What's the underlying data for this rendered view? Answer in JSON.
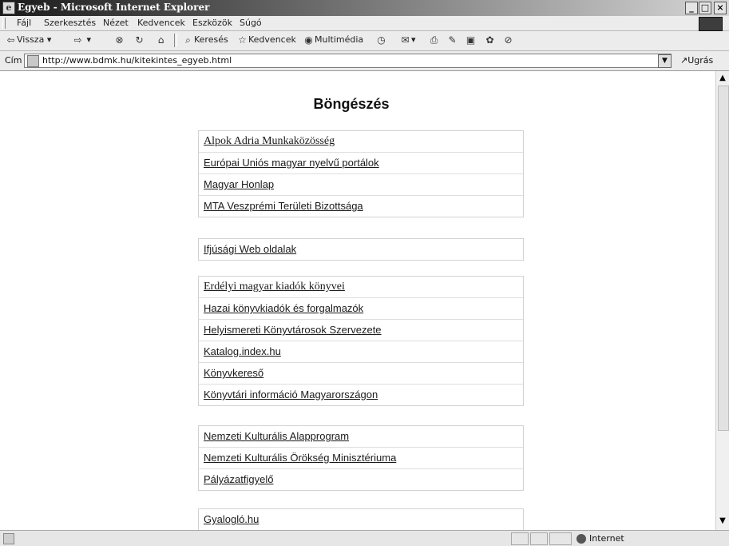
{
  "window": {
    "title": "Egyeb - Microsoft Internet Explorer",
    "buttons": {
      "minimize": "_",
      "maximize": "□",
      "close": "×"
    }
  },
  "menu": [
    "Fájl",
    "Szerkesztés",
    "Nézet",
    "Kedvencek",
    "Eszközök",
    "Súgó"
  ],
  "toolbar": {
    "back": "Vissza",
    "search": "Keresés",
    "favorites": "Kedvencek",
    "media": "Multimédia"
  },
  "address": {
    "label": "Cím",
    "url": "http://www.bdmk.hu/kitekintes_egyeb.html",
    "go": "Ugrás"
  },
  "page": {
    "title": "Böngészés",
    "groups": [
      [
        "Alpok Adria Munkaközösség",
        "Európai Uniós magyar nyelvű portálok",
        "Magyar Honlap",
        "MTA Veszprémi Területi Bizottsága"
      ],
      [
        "Ifjúsági Web oldalak"
      ],
      [
        "Erdélyi magyar kiadók könyvei",
        "Hazai könyvkiadók és forgalmazók",
        "Helyismereti Könyvtárosok Szervezete",
        "Katalog.index.hu",
        "Könyvkereső",
        "Könyvtári információ Magyarországon"
      ],
      [
        "Nemzeti Kulturális Alapprogram",
        "Nemzeti Kulturális Örökség Minisztériuma",
        "Pályázatfigyelő"
      ],
      [
        "Gyalogló.hu"
      ]
    ]
  },
  "status": {
    "zone": "Internet"
  }
}
